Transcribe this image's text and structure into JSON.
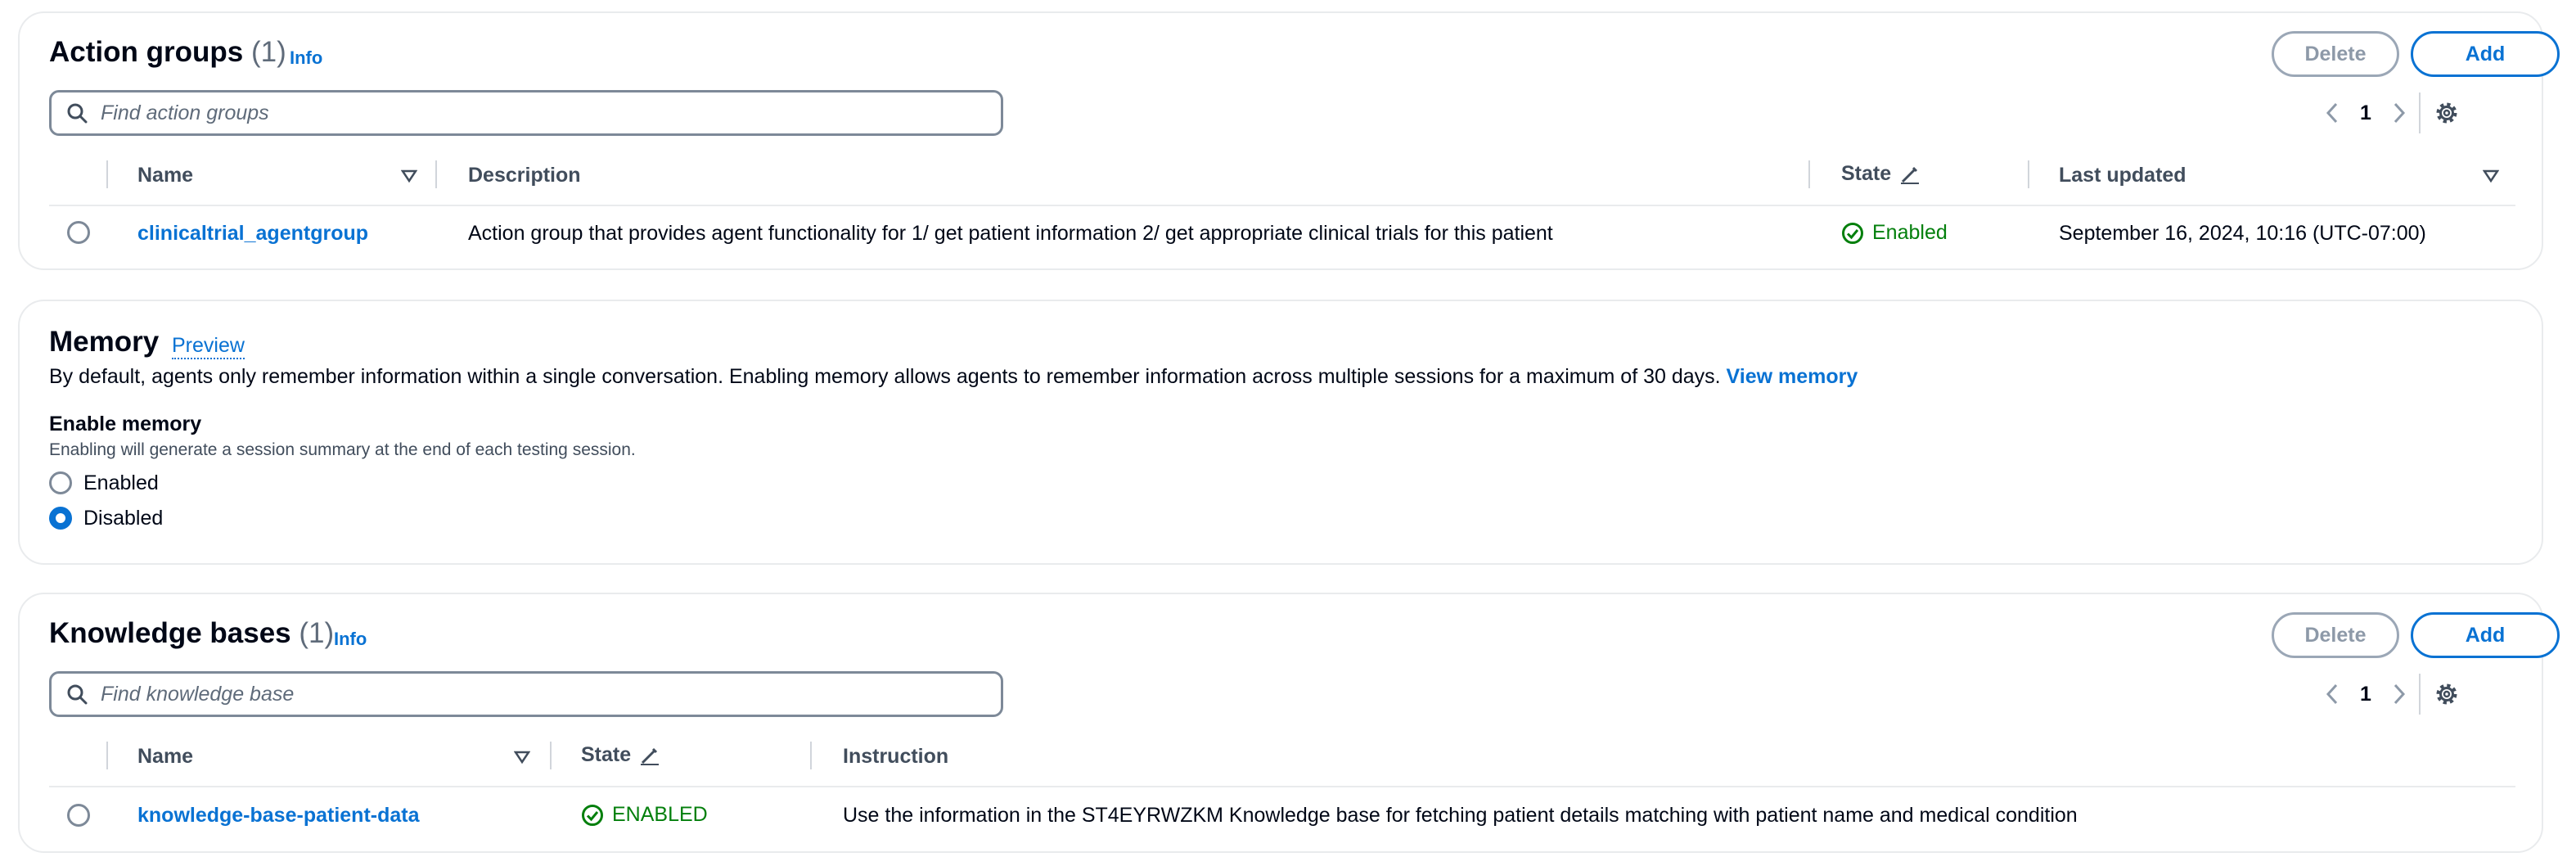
{
  "action_groups": {
    "title": "Action groups",
    "count": "(1)",
    "info": "Info",
    "delete_label": "Delete",
    "add_label": "Add",
    "search_placeholder": "Find action groups",
    "page": "1",
    "columns": {
      "name": "Name",
      "description": "Description",
      "state": "State",
      "last_updated": "Last updated"
    },
    "rows": [
      {
        "name": "clinicaltrial_agentgroup",
        "description": "Action group that provides agent functionality for 1/ get patient information 2/ get appropriate clinical trials for this patient",
        "state": "Enabled",
        "last_updated": "September 16, 2024, 10:16 (UTC-07:00)"
      }
    ]
  },
  "memory": {
    "title": "Memory",
    "preview": "Preview",
    "description": "By default, agents only remember information within a single conversation. Enabling memory allows agents to remember information across multiple sessions for a maximum of 30 days.",
    "view_memory": "View memory",
    "enable_label": "Enable memory",
    "enable_hint": "Enabling will generate a session summary at the end of each testing session.",
    "options": [
      "Enabled",
      "Disabled"
    ],
    "selected": "Disabled"
  },
  "knowledge_bases": {
    "title": "Knowledge bases",
    "count": "(1)",
    "info": "Info",
    "delete_label": "Delete",
    "add_label": "Add",
    "search_placeholder": "Find knowledge base",
    "page": "1",
    "columns": {
      "name": "Name",
      "state": "State",
      "instruction": "Instruction"
    },
    "rows": [
      {
        "name": "knowledge-base-patient-data",
        "state": "ENABLED",
        "instruction": "Use the information in the ST4EYRWZKM Knowledge base for fetching patient details matching with patient name and medical condition"
      }
    ]
  },
  "colors": {
    "link": "#0972d3",
    "success": "#037f0c",
    "border": "#e9ebed",
    "heading": "#000716"
  },
  "icons": [
    "search-icon",
    "sort-caret-icon",
    "edit-pencil-icon",
    "status-check-icon",
    "chevron-left-icon",
    "chevron-right-icon",
    "gear-icon"
  ]
}
